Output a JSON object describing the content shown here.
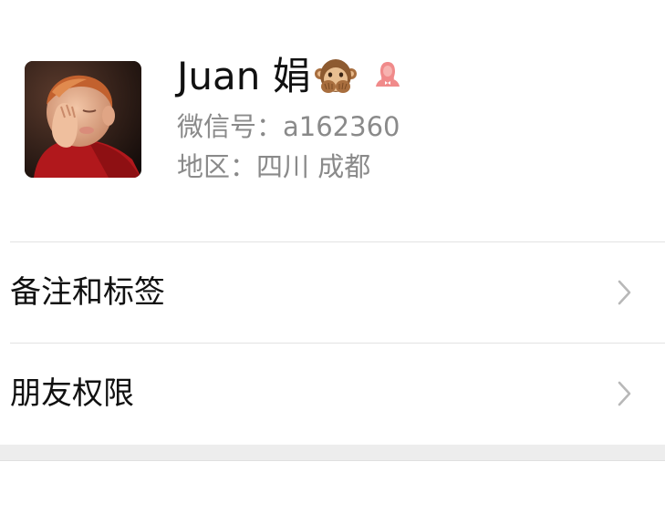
{
  "profile": {
    "name": "Juan 娟",
    "name_emoji_icon": "see-no-evil-monkey-icon",
    "gender_icon": "female-user-icon",
    "gender_color": "#f08a8a",
    "wechat_id": "微信号：a162360",
    "region": "地区：四川 成都"
  },
  "menu": {
    "items": [
      {
        "label": "备注和标签",
        "icon": "chevron-right-icon"
      },
      {
        "label": "朋友权限",
        "icon": "chevron-right-icon"
      }
    ]
  },
  "colors": {
    "text_primary": "#111111",
    "text_secondary": "#8a8a8a",
    "divider": "#e3e3e3",
    "section_gap": "#ededed",
    "chevron": "#b8b8b8"
  }
}
